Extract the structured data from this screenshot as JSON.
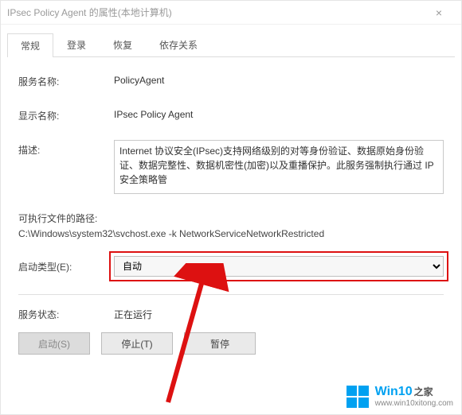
{
  "window": {
    "title": "IPsec Policy Agent 的属性(本地计算机)",
    "close": "×"
  },
  "tabs": {
    "items": [
      {
        "label": "常规",
        "active": true
      },
      {
        "label": "登录",
        "active": false
      },
      {
        "label": "恢复",
        "active": false
      },
      {
        "label": "依存关系",
        "active": false
      }
    ]
  },
  "fields": {
    "service_name_label": "服务名称:",
    "service_name_value": "PolicyAgent",
    "display_name_label": "显示名称:",
    "display_name_value": "IPsec Policy Agent",
    "description_label": "描述:",
    "description_value": "Internet 协议安全(IPsec)支持网络级别的对等身份验证、数据原始身份验证、数据完整性、数据机密性(加密)以及重播保护。此服务强制执行通过 IP 安全策略管",
    "exec_label": "可执行文件的路径:",
    "exec_value": "C:\\Windows\\system32\\svchost.exe -k NetworkServiceNetworkRestricted",
    "startup_label": "启动类型(E):",
    "startup_value": "自动",
    "status_label": "服务状态:",
    "status_value": "正在运行"
  },
  "buttons": {
    "start": "启动(S)",
    "stop": "停止(T)",
    "pause": "暂停"
  },
  "watermark": {
    "brand": "Win10",
    "brand_suffix": "之家",
    "url": "www.win10xitong.com"
  }
}
